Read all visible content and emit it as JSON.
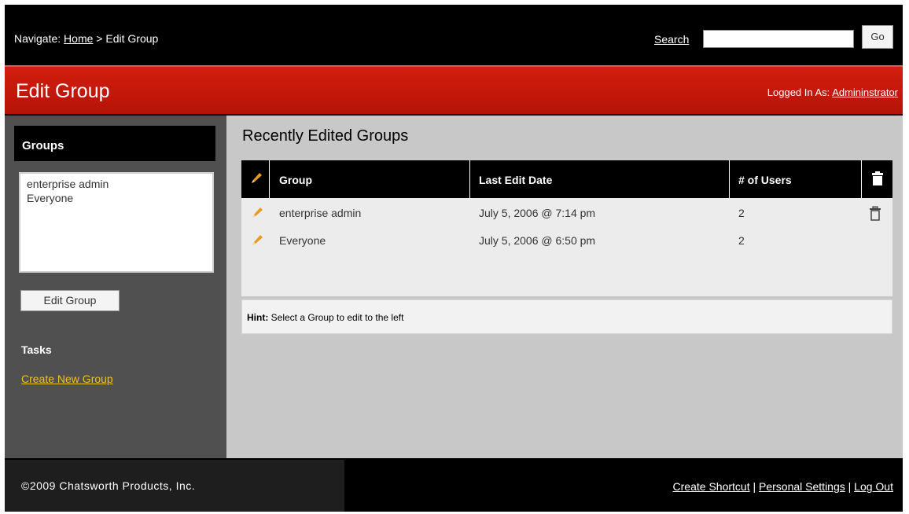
{
  "nav": {
    "prefix": "Navigate: ",
    "home_link": "Home",
    "separator": " > ",
    "current": "Edit Group"
  },
  "search": {
    "label": "Search",
    "value": "",
    "go_label": "Go"
  },
  "title": {
    "page_title": "Edit Group",
    "logged_prefix": "Logged In As: ",
    "user": "Admininstrator"
  },
  "sidebar": {
    "groups_heading": "Groups",
    "group_options": [
      "enterprise admin",
      "Everyone"
    ],
    "edit_button": "Edit Group",
    "tasks_heading": "Tasks",
    "create_link": "Create New Group"
  },
  "main": {
    "section_title": "Recently Edited Groups",
    "columns": [
      "Group",
      "Last Edit Date",
      "# of Users"
    ],
    "rows": [
      {
        "group": "enterprise admin",
        "date": "July 5, 2006 @ 7:14 pm",
        "users": "2"
      },
      {
        "group": "Everyone",
        "date": "July 5, 2006 @ 6:50 pm",
        "users": "2"
      }
    ],
    "hint_label": "Hint:",
    "hint_text": " Select a Group to edit to the left"
  },
  "footer": {
    "copyright": "©2009 Chatsworth Products, Inc.",
    "links": [
      "Create Shortcut",
      "Personal Settings",
      "Log Out"
    ],
    "link_sep": " | "
  },
  "colors": {
    "title_bar": "#c4190b",
    "sidebar_bg": "#505050",
    "main_bg": "#c8c8c8",
    "link_accent": "#f1c21b",
    "pencil": "#e79a1f"
  },
  "icons": {
    "edit": "pencil-icon",
    "delete": "trash-icon"
  }
}
